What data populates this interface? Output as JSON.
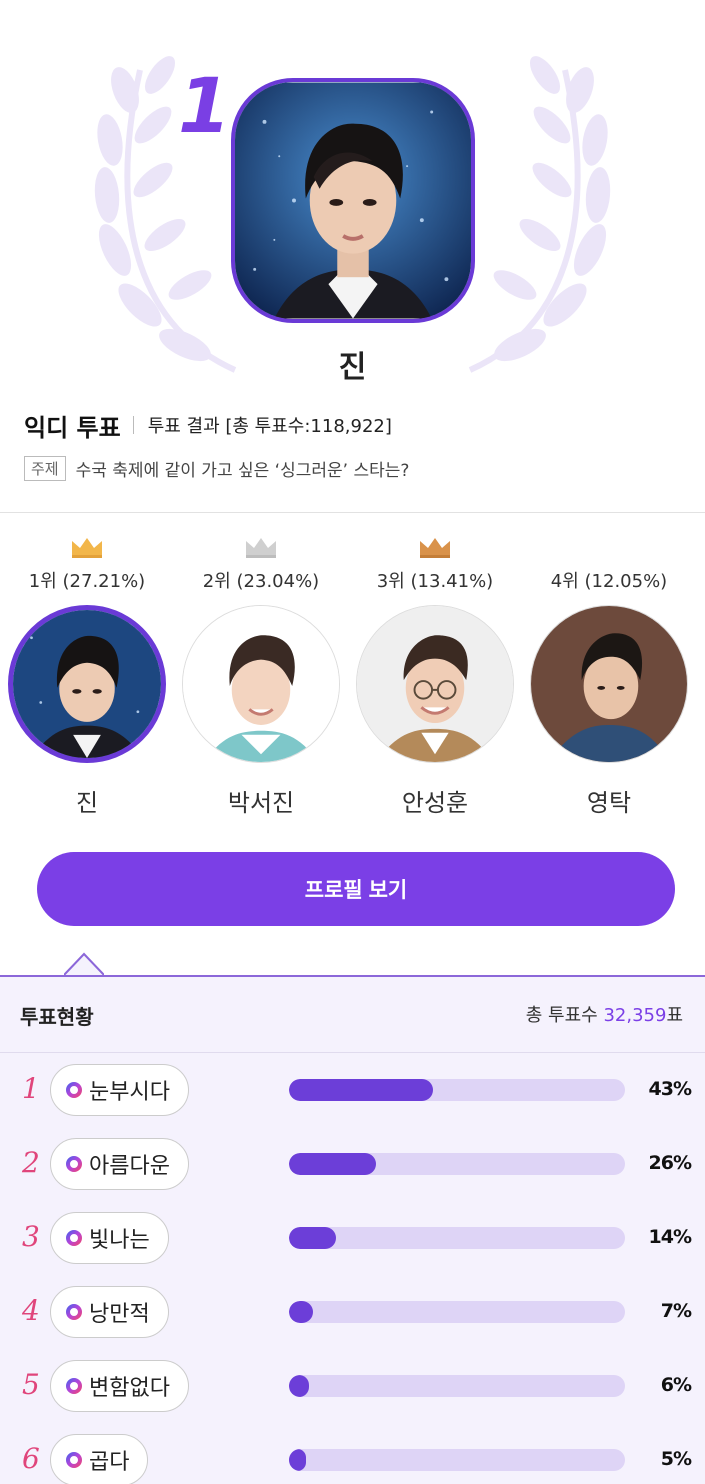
{
  "hero": {
    "rank": "1",
    "winner_name": "진"
  },
  "header": {
    "brand": "익디 투표",
    "result_label": "투표 결과 [총 투표수:118,922]",
    "topic_tag": "주제",
    "topic_text": "수국 축제에 같이 가고 싶은 ‘싱그러운’ 스타는?"
  },
  "rankers": [
    {
      "rank_text": "1위 (27.21%)",
      "name": "진",
      "crown": "gold-crown-icon",
      "color": "#f2b64a"
    },
    {
      "rank_text": "2위 (23.04%)",
      "name": "박서진",
      "crown": "silver-crown-icon",
      "color": "#c9c9c9"
    },
    {
      "rank_text": "3위 (13.41%)",
      "name": "안성훈",
      "crown": "bronze-crown-icon",
      "color": "#d9924a"
    },
    {
      "rank_text": "4위 (12.05%)",
      "name": "영탁",
      "crown": "",
      "color": ""
    }
  ],
  "profile_button": "프로필 보기",
  "status": {
    "title": "투표현황",
    "total_prefix": "총 투표수 ",
    "total_value": "32,359",
    "total_suffix": "표",
    "rows": [
      {
        "rank": "1",
        "label": "눈부시다",
        "percent_text": "43%",
        "percent": 43
      },
      {
        "rank": "2",
        "label": "아름다운",
        "percent_text": "26%",
        "percent": 26
      },
      {
        "rank": "3",
        "label": "빛나는",
        "percent_text": "14%",
        "percent": 14
      },
      {
        "rank": "4",
        "label": "낭만적",
        "percent_text": "7%",
        "percent": 7
      },
      {
        "rank": "5",
        "label": "변함없다",
        "percent_text": "6%",
        "percent": 6
      },
      {
        "rank": "6",
        "label": "곱다",
        "percent_text": "5%",
        "percent": 5
      }
    ]
  },
  "colors": {
    "accent": "#7b3fe6",
    "bar_fill": "#6c3ed8",
    "bar_track": "#ded4f6",
    "rank_pink": "#e0457b"
  }
}
